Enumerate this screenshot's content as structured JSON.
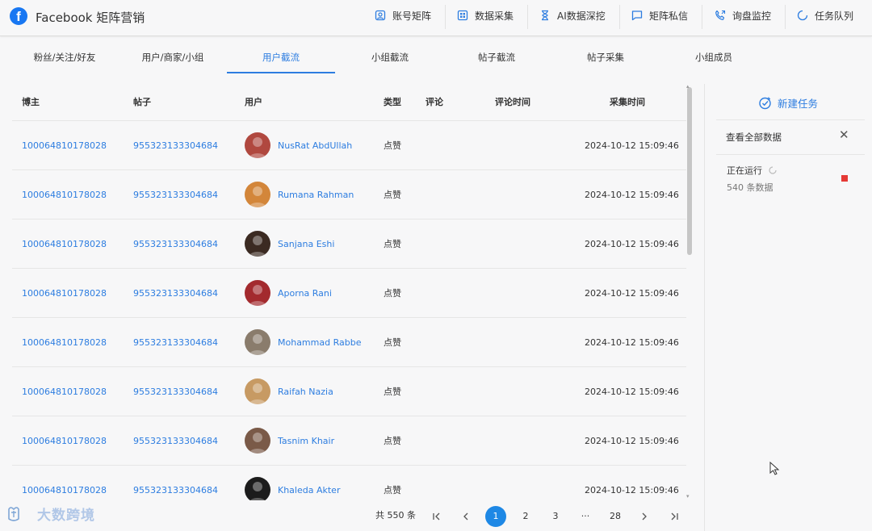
{
  "app": {
    "logo": "f",
    "title": "Facebook 矩阵营销"
  },
  "nav": [
    {
      "icon": "account-matrix-icon",
      "label": "账号矩阵"
    },
    {
      "icon": "grid-icon",
      "label": "数据采集"
    },
    {
      "icon": "hourglass-icon",
      "label": "AI数据深挖"
    },
    {
      "icon": "chat-icon",
      "label": "矩阵私信"
    },
    {
      "icon": "phone-icon",
      "label": "询盘监控"
    },
    {
      "icon": "spinner-icon",
      "label": "任务队列"
    }
  ],
  "tabs": [
    "粉丝/关注/好友",
    "用户/商家/小组",
    "用户截流",
    "小组截流",
    "帖子截流",
    "帖子采集",
    "小组成员"
  ],
  "active_tab": "用户截流",
  "columns": [
    "博主",
    "帖子",
    "用户",
    "类型",
    "评论",
    "评论时间",
    "采集时间"
  ],
  "rows": [
    {
      "blogger": "100064810178028",
      "post": "955323133304684",
      "user": "NusRat AbdUllah",
      "type": "点赞",
      "comment": "",
      "comment_time": "",
      "collect_time": "2024-10-12 15:09:46",
      "avatar_color": "#b0483f"
    },
    {
      "blogger": "100064810178028",
      "post": "955323133304684",
      "user": "Rumana Rahman",
      "type": "点赞",
      "comment": "",
      "comment_time": "",
      "collect_time": "2024-10-12 15:09:46",
      "avatar_color": "#d3863a"
    },
    {
      "blogger": "100064810178028",
      "post": "955323133304684",
      "user": "Sanjana Eshi",
      "type": "点赞",
      "comment": "",
      "comment_time": "",
      "collect_time": "2024-10-12 15:09:46",
      "avatar_color": "#3b2a22"
    },
    {
      "blogger": "100064810178028",
      "post": "955323133304684",
      "user": "Aporna Rani",
      "type": "点赞",
      "comment": "",
      "comment_time": "",
      "collect_time": "2024-10-12 15:09:46",
      "avatar_color": "#a32a2e"
    },
    {
      "blogger": "100064810178028",
      "post": "955323133304684",
      "user": "Mohammad Rabbe",
      "type": "点赞",
      "comment": "",
      "comment_time": "",
      "collect_time": "2024-10-12 15:09:46",
      "avatar_color": "#8a7c6c"
    },
    {
      "blogger": "100064810178028",
      "post": "955323133304684",
      "user": "Raifah Nazia",
      "type": "点赞",
      "comment": "",
      "comment_time": "",
      "collect_time": "2024-10-12 15:09:46",
      "avatar_color": "#c79a63"
    },
    {
      "blogger": "100064810178028",
      "post": "955323133304684",
      "user": "Tasnim Khair",
      "type": "点赞",
      "comment": "",
      "comment_time": "",
      "collect_time": "2024-10-12 15:09:46",
      "avatar_color": "#7a5a48"
    },
    {
      "blogger": "100064810178028",
      "post": "955323133304684",
      "user": "Khaleda Akter",
      "type": "点赞",
      "comment": "",
      "comment_time": "",
      "collect_time": "2024-10-12 15:09:46",
      "avatar_color": "#1c1c1c"
    }
  ],
  "right_panel": {
    "new_task": "新建任务",
    "view_all": "查看全部数据",
    "status": "正在运行",
    "count": "540 条数据"
  },
  "pagination": {
    "total": "共 550 条",
    "pages": [
      "1",
      "2",
      "3",
      "···",
      "28"
    ],
    "current": "1"
  },
  "watermark": "大数跨境"
}
